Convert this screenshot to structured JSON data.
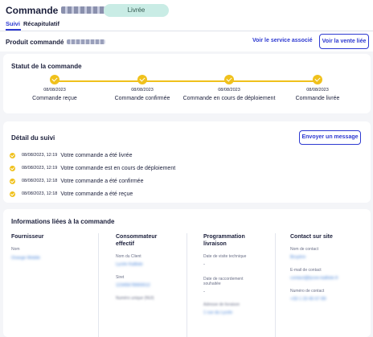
{
  "header": {
    "title_prefix": "Commande",
    "status": "Livrée",
    "tabs": [
      {
        "label": "Suivi",
        "active": true
      },
      {
        "label": "Récapitulatif",
        "active": false
      }
    ]
  },
  "product": {
    "label": "Produit commandé",
    "service_link": "Voir le service associé",
    "sale_button": "Voir la vente liée"
  },
  "status_card": {
    "title": "Statut de la commande",
    "steps": [
      {
        "date": "08/08/2023",
        "label": "Commande reçue"
      },
      {
        "date": "08/08/2023",
        "label": "Commande confirmée"
      },
      {
        "date": "08/08/2023",
        "label": "Commande en cours de déploiement"
      },
      {
        "date": "08/08/2023",
        "label": "Commande livrée"
      }
    ]
  },
  "tracking_card": {
    "title": "Détail du suivi",
    "message_button": "Envoyer un message",
    "events": [
      {
        "date": "08/08/2023, 12:19",
        "text": "Votre commande a été livrée"
      },
      {
        "date": "08/08/2023, 12:19",
        "text": "Votre commande est en cours de déploiement"
      },
      {
        "date": "08/08/2023, 12:18",
        "text": "Votre commande a été confirmée"
      },
      {
        "date": "08/08/2023, 12:18",
        "text": "Votre commande a été reçue"
      }
    ]
  },
  "info_card": {
    "title": "Informations liées à la commande",
    "fournisseur": {
      "title": "Fournisseur",
      "nom_label": "Nom",
      "nom_value": "Orange Mobile"
    },
    "consommateur": {
      "title_line1": "Consommateur",
      "title_line2": "effectif",
      "client_label": "Nom du Client",
      "client_value": "Lycée Kalliste",
      "siret_label": "Siret",
      "siret_value": "12345678900012",
      "extra_label": "Numéro unique (NUI)"
    },
    "programmation": {
      "title_line1": "Programmation",
      "title_line2": "livraison",
      "visite_label": "Date de visite technique",
      "visite_value": "-",
      "raccordement_label1": "Date de raccordement",
      "raccordement_label2": "souhaitée",
      "raccordement_value": "-",
      "adresse_label": "Adresse de livraison",
      "adresse_value": "1 rue du Lycée"
    },
    "contact": {
      "title": "Contact sur site",
      "nom_label": "Nom de contact",
      "nom_value": "Bruyère",
      "email_label": "E-mail de contact",
      "email_value": "contact@lycee-kalliste.fr",
      "tel_label": "Numéro de contact",
      "tel_value": "+33 1 23 45 67 89"
    }
  }
}
